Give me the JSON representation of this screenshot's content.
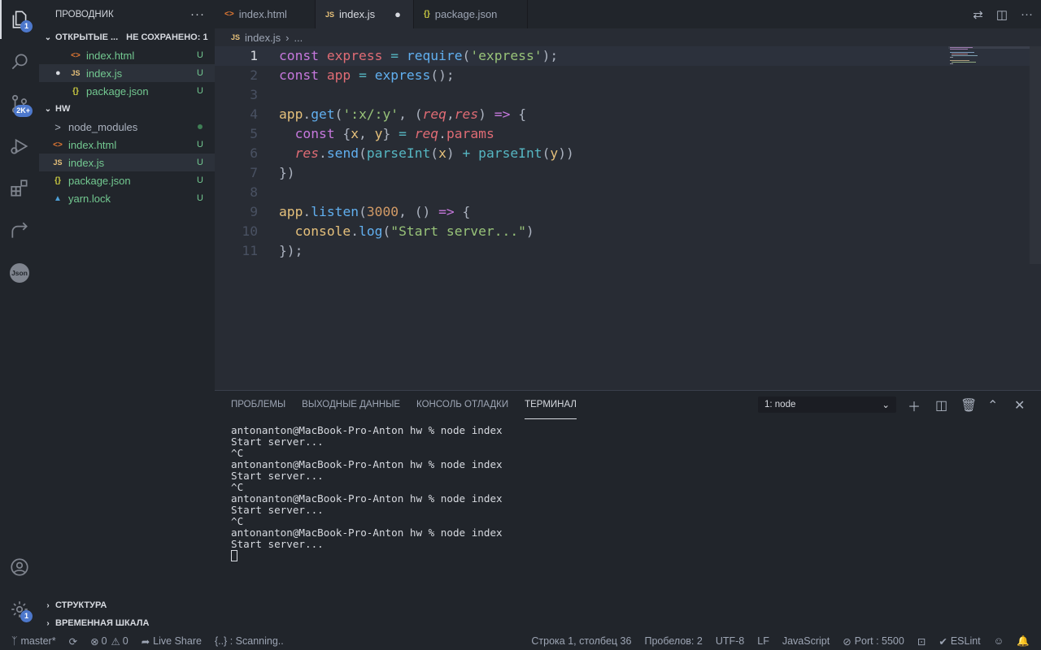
{
  "activity": {
    "explorer_badge": "1",
    "scm_badge": "2K+",
    "settings_badge": "1",
    "json_label": "Json"
  },
  "sidebar": {
    "title": "ПРОВОДНИК",
    "more": "···",
    "open_editors": {
      "label": "ОТКРЫТЫЕ ...",
      "unsaved": "НЕ СОХРАНЕНО: 1",
      "items": [
        {
          "icon": "<>",
          "name": "index.html",
          "status": "U"
        },
        {
          "icon": "JS",
          "name": "index.js",
          "status": "U"
        },
        {
          "icon": "{}",
          "name": "package.json",
          "status": "U"
        }
      ]
    },
    "workspace": {
      "label": "HW",
      "items": [
        {
          "icon": ">",
          "name": "node_modules",
          "status": ""
        },
        {
          "icon": "<>",
          "name": "index.html",
          "status": "U"
        },
        {
          "icon": "JS",
          "name": "index.js",
          "status": "U"
        },
        {
          "icon": "{}",
          "name": "package.json",
          "status": "U"
        },
        {
          "icon": "lock",
          "name": "yarn.lock",
          "status": "U"
        }
      ]
    },
    "outline": "СТРУКТУРА",
    "timeline": "ВРЕМЕННАЯ ШКАЛА"
  },
  "tabs": [
    {
      "icon": "<>",
      "label": "index.html",
      "active": false
    },
    {
      "icon": "JS",
      "label": "index.js",
      "active": true
    },
    {
      "icon": "{}",
      "label": "package.json",
      "active": false
    }
  ],
  "breadcrumb": {
    "file": "index.js",
    "rest": "..."
  },
  "editor": {
    "line_numbers": [
      "1",
      "2",
      "3",
      "4",
      "5",
      "6",
      "7",
      "8",
      "9",
      "10",
      "11"
    ]
  },
  "panel": {
    "tabs": [
      "ПРОБЛЕМЫ",
      "ВЫХОДНЫЕ ДАННЫЕ",
      "КОНСОЛЬ ОТЛАДКИ",
      "ТЕРМИНАЛ"
    ],
    "terminal_select": "1: node",
    "terminal_lines": [
      "antonanton@MacBook-Pro-Anton hw % node index",
      "Start server...",
      "^C",
      "antonanton@MacBook-Pro-Anton hw % node index",
      "Start server...",
      "^C",
      "antonanton@MacBook-Pro-Anton hw % node index",
      "Start server...",
      "^C",
      "antonanton@MacBook-Pro-Anton hw % node index",
      "Start server..."
    ]
  },
  "status": {
    "branch": "master*",
    "errors": "0",
    "warnings": "0",
    "live_share": "Live Share",
    "scanning": "{..} : Scanning..",
    "position": "Строка 1, столбец 36",
    "spaces": "Пробелов: 2",
    "encoding": "UTF-8",
    "eol": "LF",
    "language": "JavaScript",
    "port": "Port : 5500",
    "eslint": "ESLint"
  }
}
